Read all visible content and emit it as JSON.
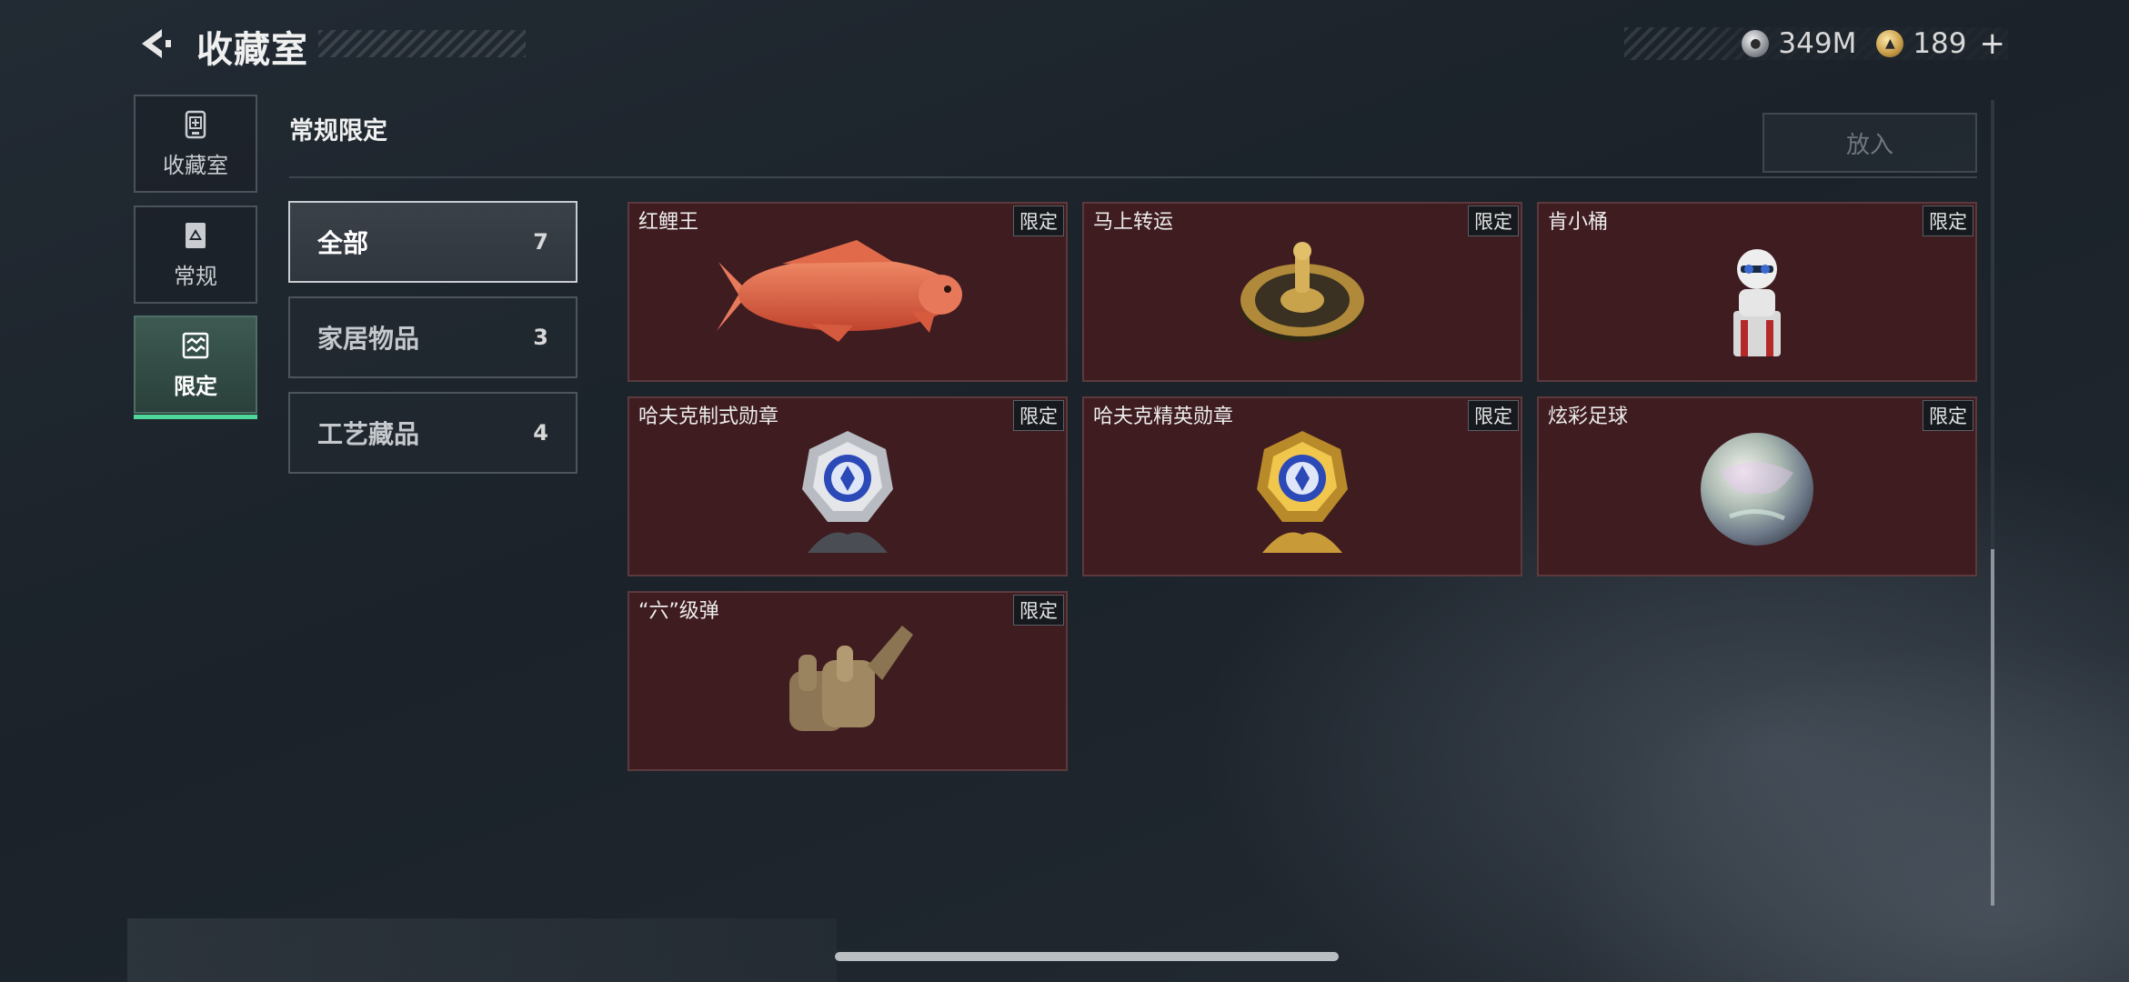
{
  "header": {
    "title": "收藏室",
    "currency": [
      {
        "icon": "silver-coin-icon",
        "value": "349M"
      },
      {
        "icon": "gold-coin-icon",
        "value": "189"
      }
    ],
    "plus_label": "+"
  },
  "sidebar": {
    "items": [
      {
        "label": "收藏室",
        "icon": "vault-icon",
        "active": false
      },
      {
        "label": "常规",
        "icon": "card-icon",
        "active": false
      },
      {
        "label": "限定",
        "icon": "limited-icon",
        "active": true
      }
    ]
  },
  "section": {
    "title": "常规限定",
    "put_in_label": "放入"
  },
  "categories": [
    {
      "label": "全部",
      "count": "7",
      "active": true
    },
    {
      "label": "家居物品",
      "count": "3",
      "active": false
    },
    {
      "label": "工艺藏品",
      "count": "4",
      "active": false
    }
  ],
  "items": [
    {
      "name": "红鲤王",
      "tag": "限定",
      "art": "carp"
    },
    {
      "name": "马上转运",
      "tag": "限定",
      "art": "compass"
    },
    {
      "name": "肯小桶",
      "tag": "限定",
      "art": "colonel"
    },
    {
      "name": "哈夫克制式勋章",
      "tag": "限定",
      "art": "silver-medal"
    },
    {
      "name": "哈夫克精英勋章",
      "tag": "限定",
      "art": "gold-medal"
    },
    {
      "name": "炫彩足球",
      "tag": "限定",
      "art": "football"
    },
    {
      "name": "“六”级弹",
      "tag": "限定",
      "art": "hand"
    }
  ],
  "colors": {
    "card_bg": "#3f1c20",
    "accent": "#4fd69a",
    "page_bg": "#1f262e"
  }
}
